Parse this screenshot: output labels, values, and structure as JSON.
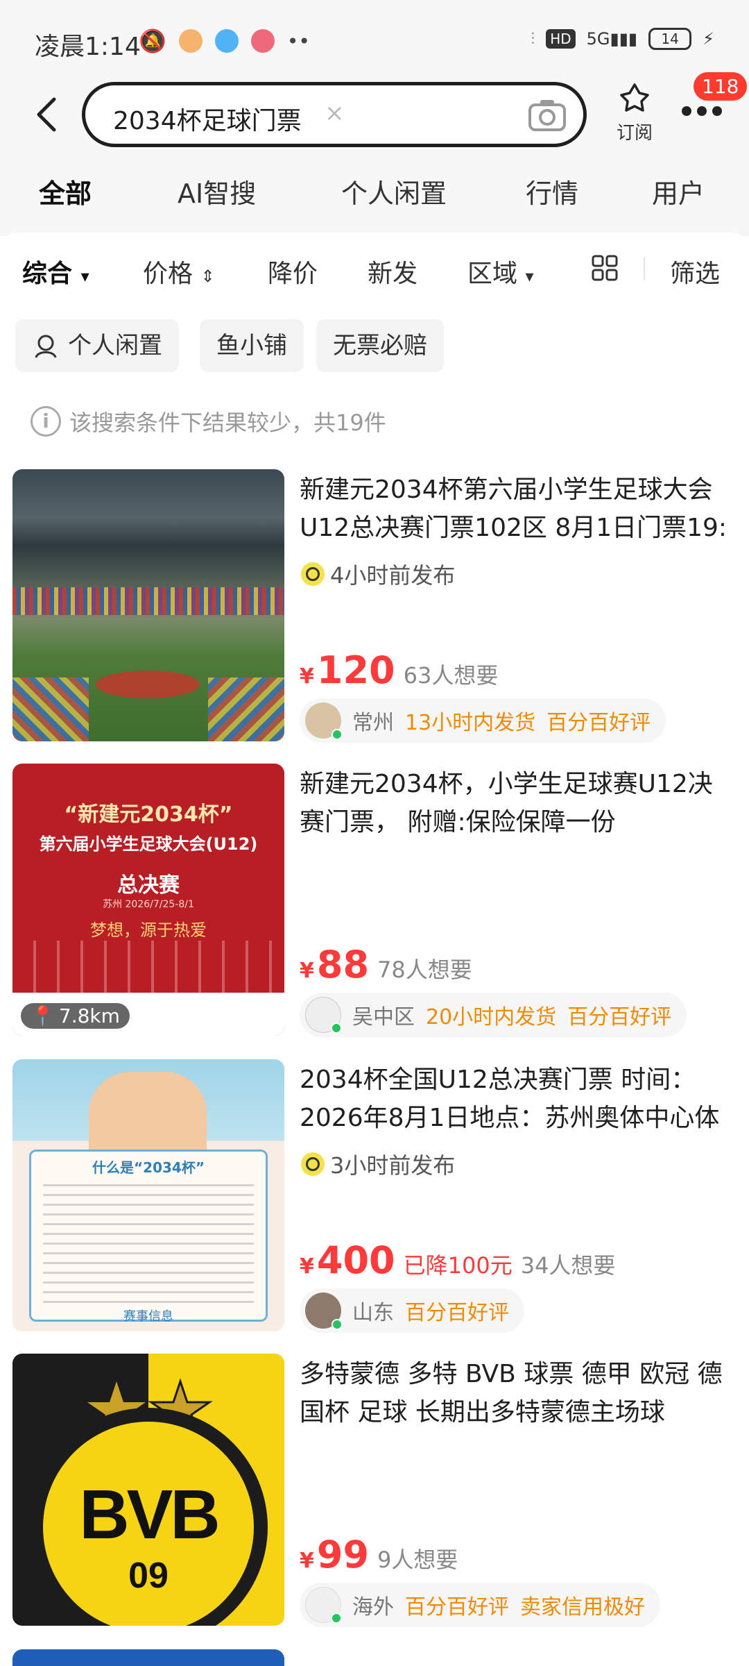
{
  "status_bar": {
    "time": "凌晨1:14",
    "network": "5G",
    "battery": "14"
  },
  "header": {
    "query": "2034杯足球门票",
    "subscribe_label": "订阅",
    "badge_count": "118"
  },
  "tabs": [
    {
      "label": "全部"
    },
    {
      "label": "AI智搜"
    },
    {
      "label": "个人闲置"
    },
    {
      "label": "行情"
    },
    {
      "label": "用户"
    }
  ],
  "filters": {
    "sort": "综合",
    "price": "价格",
    "discount": "降价",
    "new": "新发",
    "region": "区域",
    "filter": "筛选"
  },
  "chips": [
    "个人闲置",
    "鱼小铺",
    "无票必赔"
  ],
  "info_text": "该搜索条件下结果较少，共19件",
  "currency": "¥",
  "items": [
    {
      "title": "新建元2034杯第六届小学生足球大会U12总决赛门票102区 8月1日门票19:",
      "published": "4小时前发布",
      "price": "120",
      "want": "63人想要",
      "location": "常州",
      "tag1": "13小时内发货",
      "tag2": "百分百好评"
    },
    {
      "title": "新建元2034杯，小学生足球赛U12决赛门票， 附赠:保险保障一份",
      "distance": "7.8km",
      "price": "88",
      "want": "78人想要",
      "location": "吴中区",
      "tag1": "20小时内发货",
      "tag2": "百分百好评",
      "thumb_text": {
        "line1": "“新建元2034杯”",
        "line2": "第六届小学生足球大会(U12)",
        "line3": "总决赛",
        "line4": "苏州 2026/7/25-8/1",
        "line5": "梦想，源于热爱"
      }
    },
    {
      "title": "2034杯全国U12总决赛门票 时间：2026年8月1日地点：苏州奥体中心体",
      "published": "3小时前发布",
      "price": "400",
      "drop": "已降100元",
      "want": "34人想要",
      "location": "山东",
      "tag1": "百分百好评",
      "thumb_text": {
        "heading": "什么是“2034杯”",
        "footer": "赛事信息"
      }
    },
    {
      "title": "多特蒙德 多特 BVB 球票 德甲 欧冠 德国杯 足球 长期出多特蒙德主场球",
      "price": "99",
      "want": "9人想要",
      "location": "海外",
      "tag1": "百分百好评",
      "tag2": "卖家信用极好",
      "thumb_text": {
        "logo_top": "BVB",
        "logo_bottom": "09"
      }
    }
  ],
  "colors": {
    "accent": "#ff3a3a",
    "tab_highlight": "#ffe600",
    "tag": "#f08a00",
    "online": "#22c55e"
  }
}
